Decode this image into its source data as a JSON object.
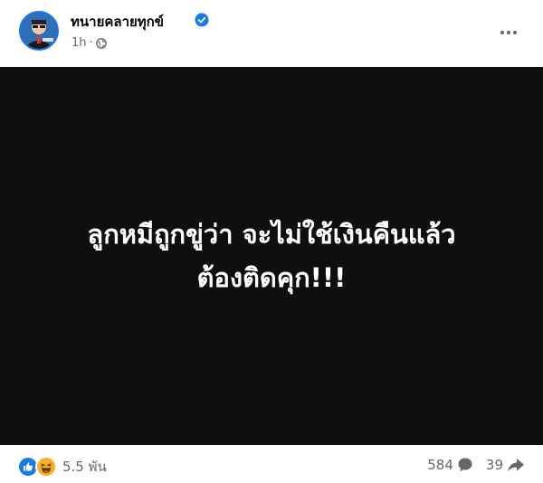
{
  "post": {
    "author": "ทนายคลายทุกข์",
    "time": "1h",
    "separator": "·",
    "privacy_icon": "globe-icon",
    "verified_icon": "verified-badge-icon",
    "more_icon": "more-horizontal-icon",
    "image_text": {
      "line1": "ลูกหมีถูกขู่ว่า จะไม่ใช้เงินคืนแล้ว",
      "line2": "ต้องติดคุก!!!"
    }
  },
  "footer": {
    "reaction_icons": [
      "like-icon",
      "haha-icon"
    ],
    "reaction_count": "5.5 พัน",
    "comment_count": "584",
    "share_count": "39",
    "comment_icon": "comment-bubble-icon",
    "share_icon": "share-arrow-icon"
  },
  "colors": {
    "like": "#1877f2",
    "haha": "#f7b125",
    "image_bg": "#0f0f0f",
    "secondary_text": "#65676b"
  }
}
